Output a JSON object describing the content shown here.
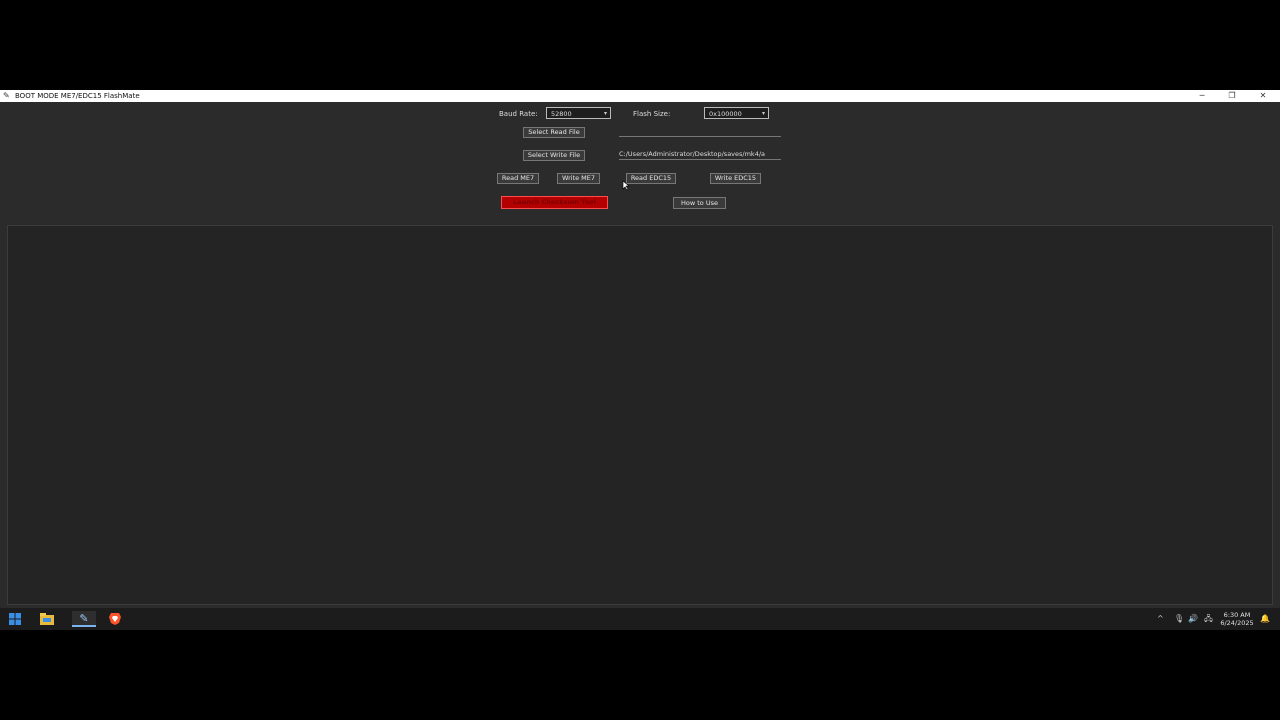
{
  "window": {
    "title": "BOOT MODE ME7/EDC15 FlashMate",
    "controls": {
      "minimize": "─",
      "maximize": "❐",
      "close": "✕"
    }
  },
  "form": {
    "baud_label": "Baud Rate:",
    "baud_value": "52800",
    "flash_label": "Flash Size:",
    "flash_value": "0x100000",
    "select_read_label": "Select Read File",
    "read_path": "",
    "select_write_label": "Select Write File",
    "write_path": "C:/Users/Administrator/Desktop/saves/mk4/a"
  },
  "actions": {
    "read_me7": "Read ME7",
    "write_me7": "Write ME7",
    "read_edc15": "Read EDC15",
    "write_edc15": "Write EDC15",
    "launch_checksum": "Launch Checksum Tool",
    "how_to_use": "How to Use"
  },
  "log": {
    "text": ""
  },
  "taskbar": {
    "icons": [
      "windows-start-icon",
      "file-explorer-icon",
      "flashmate-app-icon",
      "brave-browser-icon"
    ],
    "time": "6:30 AM",
    "date": "6/24/2025"
  },
  "colors": {
    "window_bg": "#2b2b2b",
    "log_bg": "#242424",
    "accent_red": "#b30000",
    "titlebar": "#ffffff"
  }
}
